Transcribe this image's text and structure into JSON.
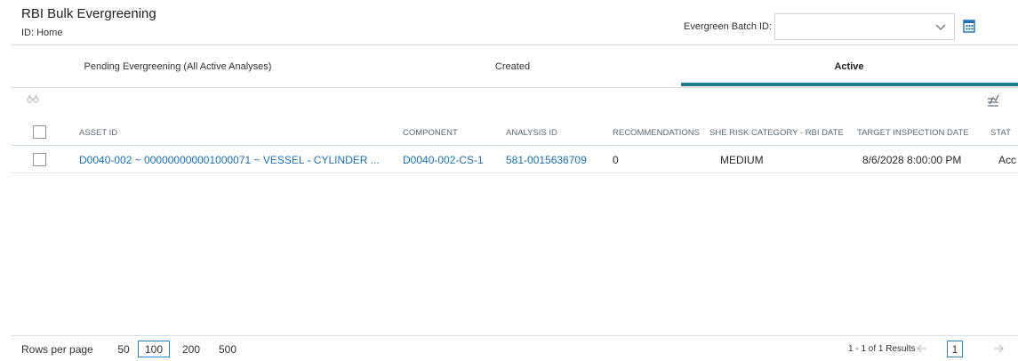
{
  "header": {
    "title": "RBI Bulk Evergreening",
    "subtitle": "ID: Home",
    "batch_label": "Evergreen Batch ID:",
    "batch_value": ""
  },
  "tabs": [
    {
      "label": "Pending Evergreening (All Active Analyses)"
    },
    {
      "label": "Created"
    },
    {
      "label": "Active",
      "selected": true
    }
  ],
  "grid": {
    "columns": [
      "ASSET ID",
      "COMPONENT",
      "ANALYSIS ID",
      "RECOMMENDATIONS",
      "SHE RISK CATEGORY - RBI DATE",
      "TARGET INSPECTION DATE",
      "STAT"
    ],
    "rows": [
      {
        "asset_id": "D0040-002 ~ 000000000001000071 ~ VESSEL - CYLINDER ...",
        "component": "D0040-002-CS-1",
        "analysis_id": "581-0015636709",
        "recommendations": "0",
        "she_risk": "MEDIUM",
        "target_date": "8/6/2028 8:00:00 PM",
        "status": "Acc"
      }
    ]
  },
  "footer": {
    "rows_per_page_label": "Rows per page",
    "page_sizes": [
      "50",
      "100",
      "200",
      "500"
    ],
    "selected_page_size": "100",
    "results_text": "1 - 1 of 1 Results",
    "current_page": "1"
  },
  "icons": {
    "dropdown": "chevron-down-icon",
    "calendar": "calendar-icon",
    "search": "binoculars-icon",
    "columns": "column-settings-icon",
    "prev": "arrow-left-icon",
    "next": "arrow-right-icon"
  },
  "colors": {
    "accent_tab": "#1e7a8c",
    "link": "#1f6fb5",
    "selected_border": "#2a82c4"
  }
}
